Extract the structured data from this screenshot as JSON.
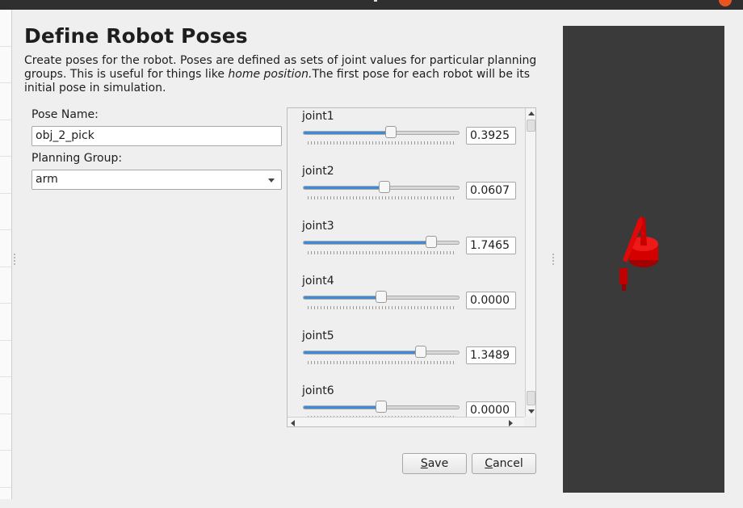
{
  "page": {
    "title": "Define Robot Poses",
    "description_part1": "Create poses for the robot. Poses are defined as sets of joint values for particular planning groups. This is useful for things like ",
    "description_italic": "home position.",
    "description_part2": "The first pose for each robot will be its initial pose in simulation."
  },
  "form": {
    "pose_name_label": "Pose Name:",
    "pose_name_value": "obj_2_pick",
    "planning_group_label": "Planning Group:",
    "planning_group_value": "arm"
  },
  "joints": [
    {
      "name": "joint1",
      "value": "0.3925",
      "fraction": 0.56
    },
    {
      "name": "joint2",
      "value": "0.0607",
      "fraction": 0.52
    },
    {
      "name": "joint3",
      "value": "1.7465",
      "fraction": 0.82
    },
    {
      "name": "joint4",
      "value": "0.0000",
      "fraction": 0.5
    },
    {
      "name": "joint5",
      "value": "1.3489",
      "fraction": 0.75
    },
    {
      "name": "joint6",
      "value": "0.0000",
      "fraction": 0.5
    }
  ],
  "buttons": {
    "save": "Save",
    "save_mnemonic": "S",
    "save_rest": "ave",
    "cancel": "Cancel",
    "cancel_mnemonic": "C",
    "cancel_rest": "ancel"
  },
  "colors": {
    "slider_fill": "#3d8ad6",
    "robot": "#d40000",
    "viewport_bg": "#3a3a3a",
    "accent": "#e95420"
  },
  "icons": {
    "combo_arrow": "chevron-down-icon",
    "scroll_up": "arrow-up-icon",
    "scroll_down": "arrow-down-icon",
    "scroll_left": "arrow-left-icon",
    "scroll_right": "arrow-right-icon"
  }
}
